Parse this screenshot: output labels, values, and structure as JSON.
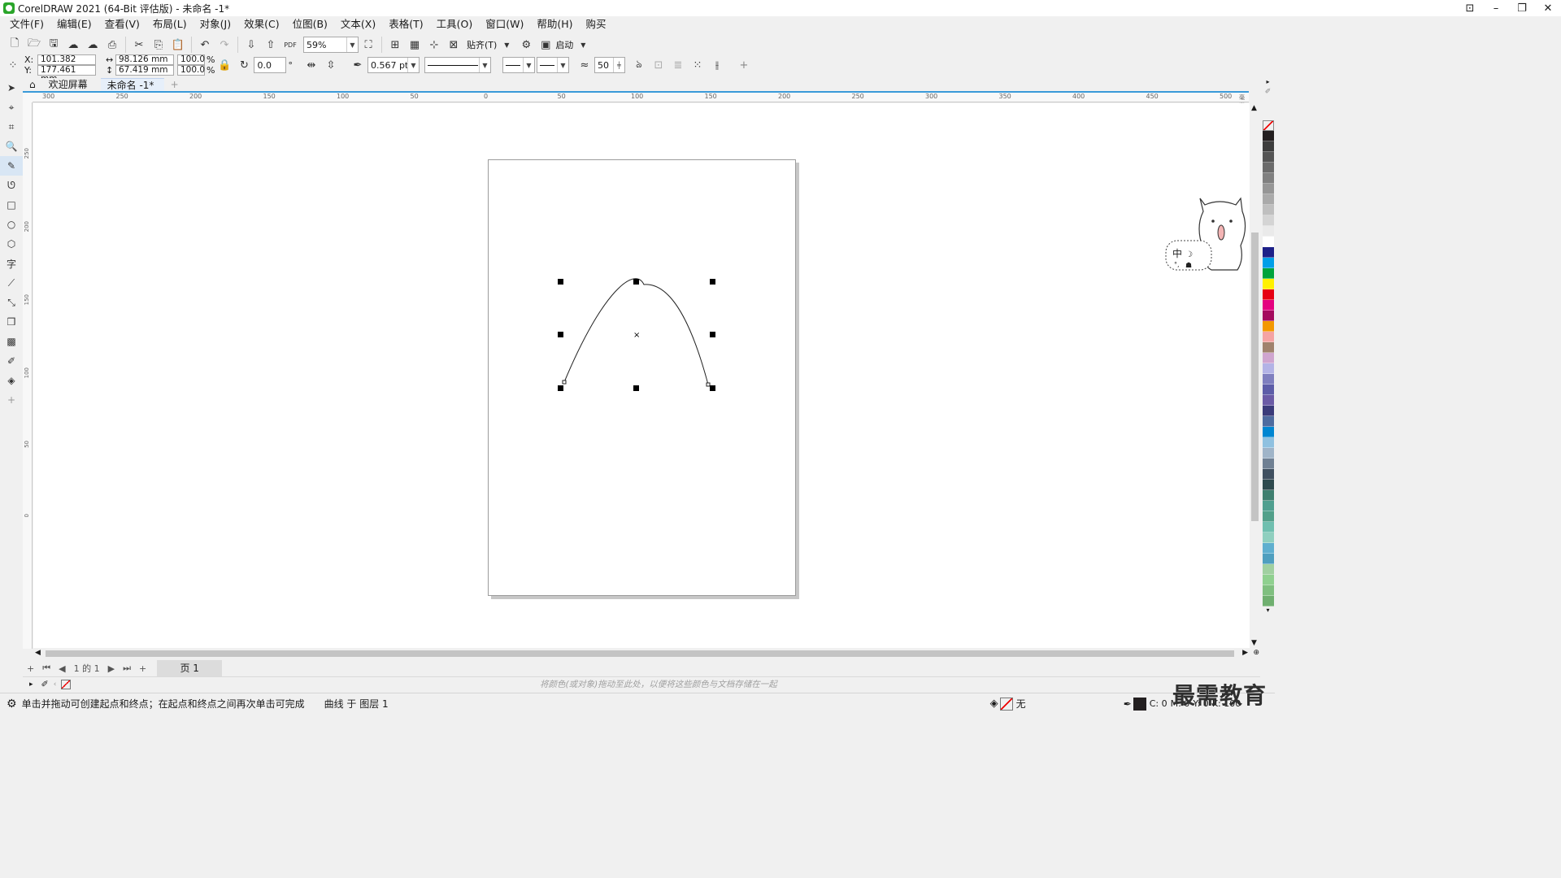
{
  "titlebar": {
    "title": "CorelDRAW 2021 (64-Bit 评估版) - 未命名 -1*"
  },
  "menu": [
    "文件(F)",
    "编辑(E)",
    "查看(V)",
    "布局(L)",
    "对象(J)",
    "效果(C)",
    "位图(B)",
    "文本(X)",
    "表格(T)",
    "工具(O)",
    "窗口(W)",
    "帮助(H)",
    "购买"
  ],
  "toolbar": {
    "zoom": "59%",
    "snap_label": "贴齐(T)",
    "launch_label": "启动"
  },
  "properties": {
    "x_label": "X:",
    "y_label": "Y:",
    "x_value": "101.382 mm",
    "y_value": "177.461 mm",
    "w_value": "98.126 mm",
    "h_value": "67.419 mm",
    "scale_w": "100.0",
    "scale_h": "100.0",
    "percent": "%",
    "rotation": "0.0",
    "outline_width": "0.567 pt",
    "smoothing": "50"
  },
  "tabs": {
    "welcome": "欢迎屏幕",
    "doc": "未命名 -1*"
  },
  "ruler_h": [
    "300",
    "250",
    "200",
    "150",
    "100",
    "50",
    "0",
    "50",
    "100",
    "150",
    "200",
    "250",
    "300",
    "350",
    "400",
    "450",
    "500"
  ],
  "ruler_h_unit": "毫米",
  "ruler_v": [
    "250",
    "200",
    "150",
    "100",
    "50",
    "0"
  ],
  "pagenav": {
    "page_counter": "1 的 1",
    "page_tab": "页 1"
  },
  "docpal_hint": "将颜色(或对象)拖动至此处，以便将这些颜色与文档存储在一起",
  "status": {
    "hint": "单击并拖动可创建起点和终点；在起点和终点之间再次单击可完成",
    "object_info": "曲线 于 图层 1",
    "fill_label": "无",
    "cmyk_c": "C: 0",
    "cmyk_m": "M: 0",
    "cmyk_y": "Y: 0",
    "cmyk_k": "K: 100"
  },
  "sticker": {
    "text": "中"
  },
  "watermark": "最需教育",
  "palette_colors": [
    "#231f20",
    "#3d3d3d",
    "#555555",
    "#6b6b6b",
    "#808080",
    "#969696",
    "#aaaaaa",
    "#bfbfbf",
    "#d4d4d4",
    "#eaeaea",
    "#ffffff",
    "#1d2088",
    "#009fe8",
    "#00a33c",
    "#fff100",
    "#e60012",
    "#e4007f",
    "#a40b5d",
    "#f39800",
    "#f5a3a3",
    "#a0826d",
    "#cfa5cf",
    "#b3b3e6",
    "#7f7fbf",
    "#5d5da8",
    "#6b5ba6",
    "#3b3b7a",
    "#4e6b9f",
    "#0086d1",
    "#8fc1e0",
    "#9fb4c8",
    "#6f8093",
    "#405060",
    "#2e4a4e",
    "#3f7f6f",
    "#4f9f8f",
    "#52a08a",
    "#6fbfaf",
    "#8fcfbf",
    "#5fafcf",
    "#4f9fbf",
    "#a0d0a0",
    "#8fd08f",
    "#7fbf7f",
    "#6faf6f"
  ]
}
